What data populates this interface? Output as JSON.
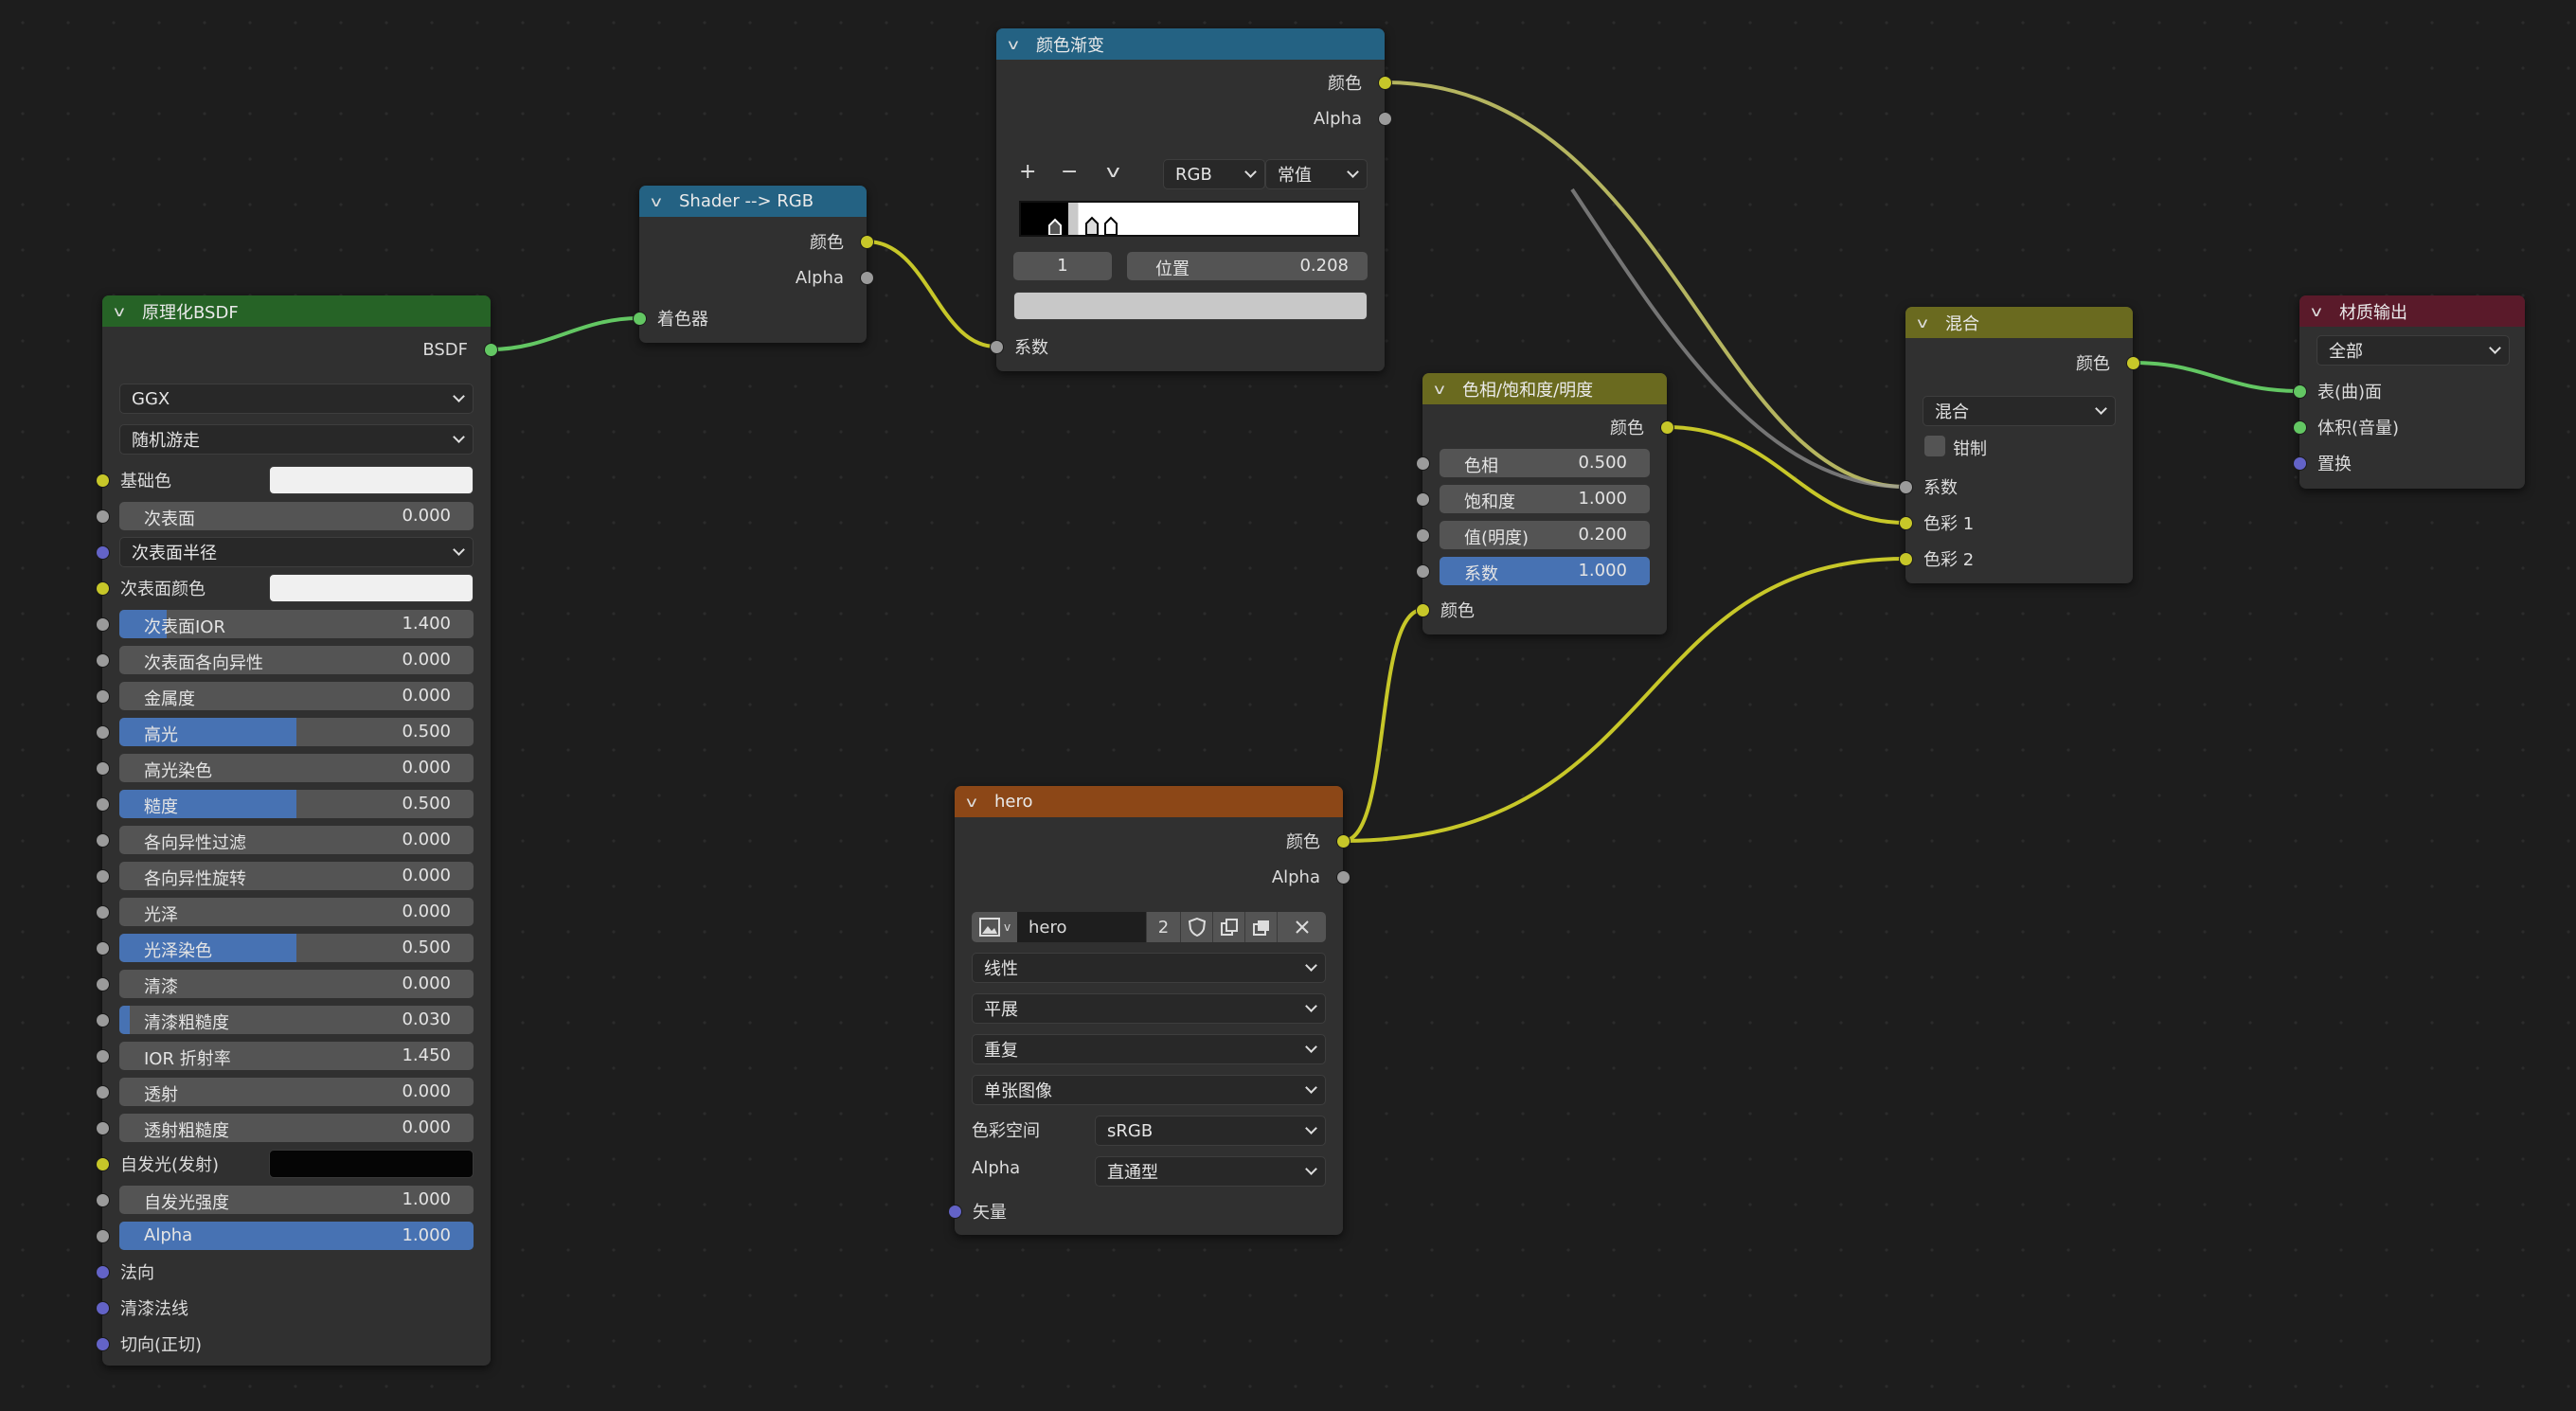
{
  "colors": {
    "wire_color": "#c7c729",
    "wire_gray": "#9b9b9b",
    "wire_shader": "#63c763"
  },
  "bsdf": {
    "title": "原理化BSDF",
    "out": "BSDF",
    "dist": "GGX",
    "sss_method": "随机游走",
    "base_color": "基础色",
    "subsurface": "次表面",
    "subsurface_val": "0.000",
    "sss_radius": "次表面半径",
    "sss_color": "次表面颜色",
    "sss_ior": "次表面IOR",
    "sss_ior_val": "1.400",
    "sss_aniso": "次表面各向异性",
    "sss_aniso_val": "0.000",
    "metallic": "金属度",
    "metallic_val": "0.000",
    "specular": "高光",
    "specular_val": "0.500",
    "spec_tint": "高光染色",
    "spec_tint_val": "0.000",
    "roughness": "糙度",
    "roughness_val": "0.500",
    "aniso": "各向异性过滤",
    "aniso_val": "0.000",
    "aniso_rot": "各向异性旋转",
    "aniso_rot_val": "0.000",
    "sheen": "光泽",
    "sheen_val": "0.000",
    "sheen_tint": "光泽染色",
    "sheen_tint_val": "0.500",
    "clearcoat": "清漆",
    "clearcoat_val": "0.000",
    "cc_rough": "清漆粗糙度",
    "cc_rough_val": "0.030",
    "ior": "IOR 折射率",
    "ior_val": "1.450",
    "trans": "透射",
    "trans_val": "0.000",
    "trans_rough": "透射粗糙度",
    "trans_rough_val": "0.000",
    "emission": "自发光(发射)",
    "em_strength": "自发光强度",
    "em_strength_val": "1.000",
    "alpha": "Alpha",
    "alpha_val": "1.000",
    "normal": "法向",
    "cc_normal": "清漆法线",
    "tangent": "切向(正切)"
  },
  "s2rgb": {
    "title": "Shader --> RGB",
    "out_color": "颜色",
    "out_alpha": "Alpha",
    "in": "着色器"
  },
  "ramp": {
    "title": "颜色渐变",
    "out_color": "颜色",
    "out_alpha": "Alpha",
    "plus": "+",
    "minus": "−",
    "mode": "RGB",
    "interp": "常值",
    "index": "1",
    "pos_label": "位置",
    "pos_val": "0.208",
    "in": "系数"
  },
  "hsv": {
    "title": "色相/饱和度/明度",
    "out": "颜色",
    "hue": "色相",
    "hue_val": "0.500",
    "sat": "饱和度",
    "sat_val": "1.000",
    "val": "值(明度)",
    "val_val": "0.200",
    "fac": "系数",
    "fac_val": "1.000",
    "in": "颜色"
  },
  "mix": {
    "title": "混合",
    "out": "颜色",
    "blend": "混合",
    "clamp": "钳制",
    "fac": "系数",
    "c1": "色彩 1",
    "c2": "色彩 2"
  },
  "out": {
    "title": "材质输出",
    "target": "全部",
    "surface": "表(曲)面",
    "volume": "体积(音量)",
    "disp": "置换"
  },
  "img": {
    "title": "hero",
    "out_color": "颜色",
    "out_alpha": "Alpha",
    "name": "hero",
    "users": "2",
    "interp": "线性",
    "proj": "平展",
    "ext": "重复",
    "src": "单张图像",
    "cs_label": "色彩空间",
    "cs": "sRGB",
    "alpha_label": "Alpha",
    "alpha_mode": "直通型",
    "vec": "矢量"
  }
}
